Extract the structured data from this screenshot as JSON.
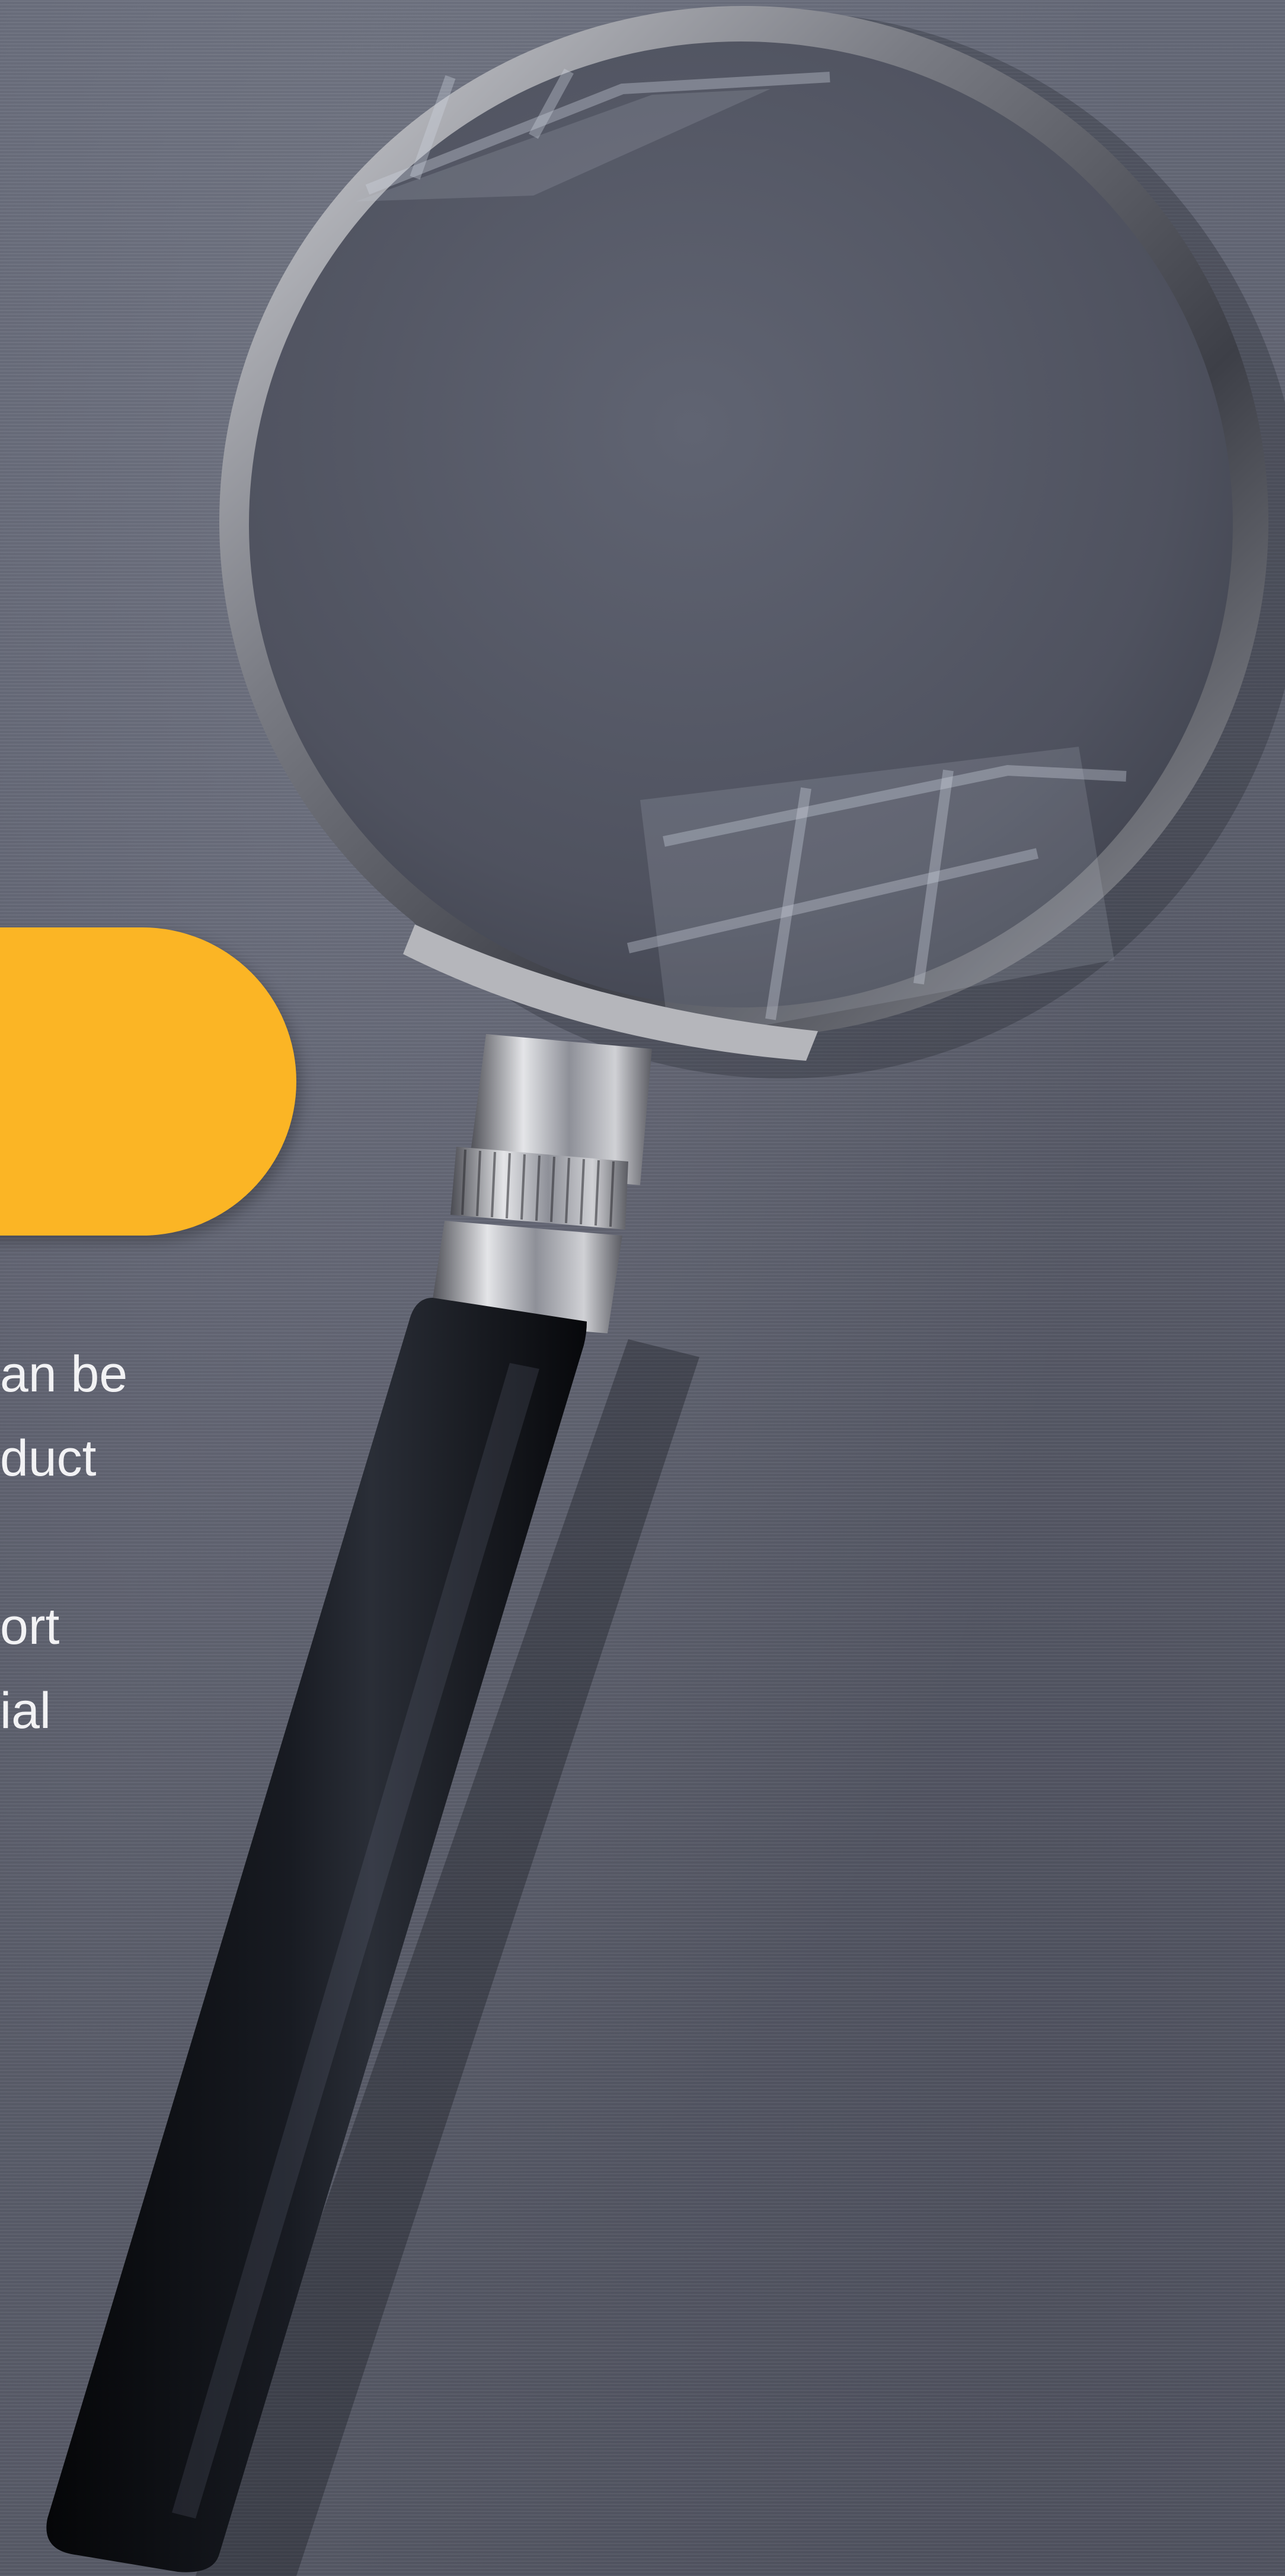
{
  "background": {
    "color": "#5d606e"
  },
  "pill": {
    "color": "#fbb525"
  },
  "text_fragments": {
    "line1": "an be",
    "line2": "duct",
    "line3": "ort",
    "line4": "ial"
  },
  "icons": {
    "object": "magnifying-glass-icon"
  }
}
